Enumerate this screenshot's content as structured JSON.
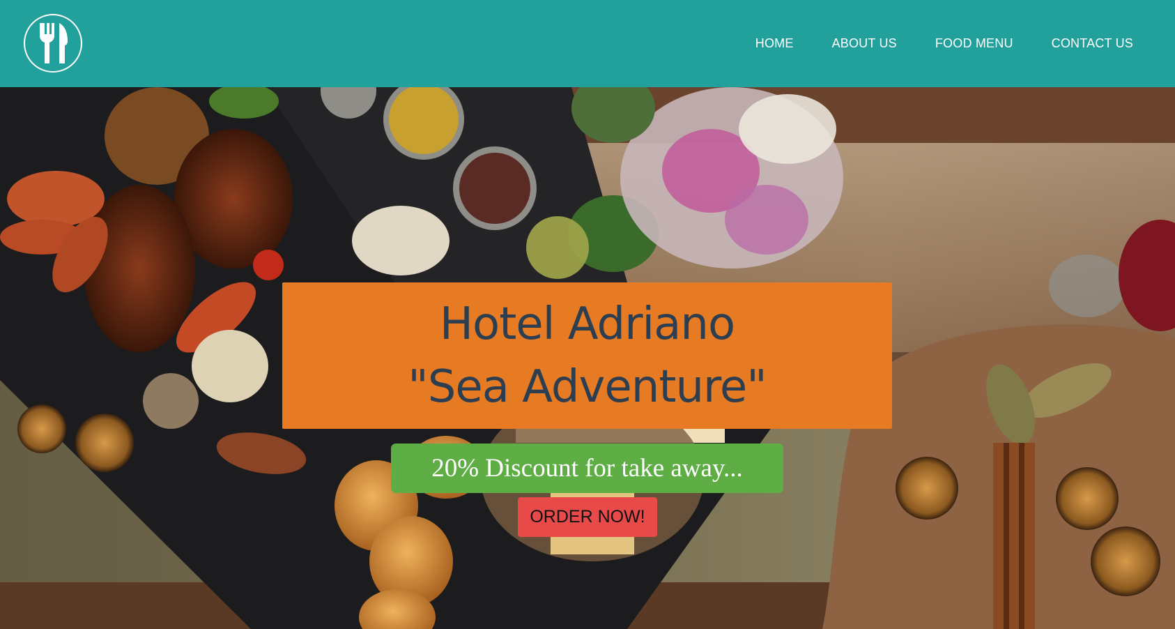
{
  "header": {
    "bg_color": "#22a09b",
    "logo_icon": "fork-knife-icon",
    "nav": [
      {
        "label": "HOME"
      },
      {
        "label": "ABOUT US"
      },
      {
        "label": "FOOD MENU"
      },
      {
        "label": "CONTACT US"
      }
    ]
  },
  "hero": {
    "title_line1": "Hotel Adriano",
    "title_line2": "\"Sea Adventure\"",
    "title_bg_color": "#e77b24",
    "title_text_color": "#2c3e50",
    "discount_text": "20% Discount for take away...",
    "discount_bg_color": "#5fad45",
    "order_button_label": "ORDER NOW!",
    "order_button_color": "#e84a4a"
  }
}
